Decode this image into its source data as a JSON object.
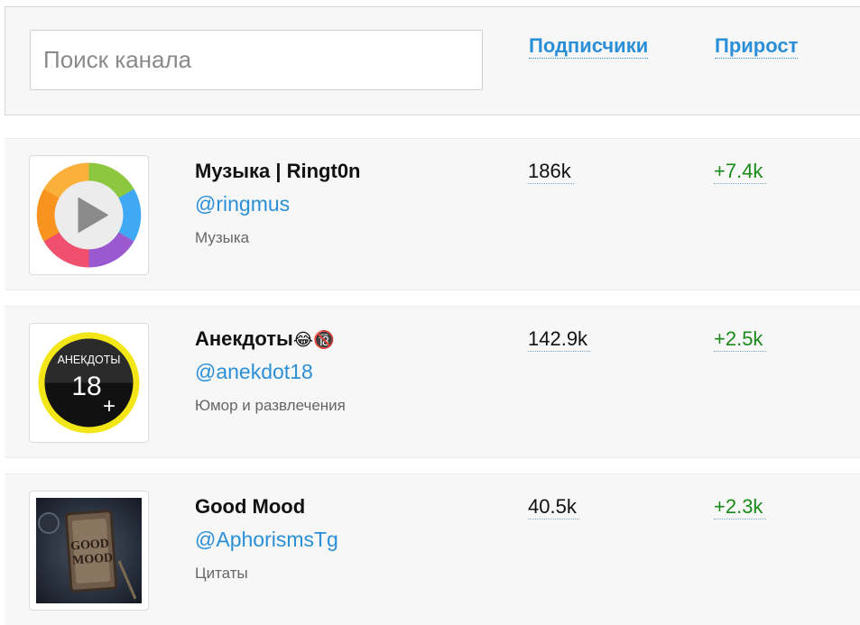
{
  "search": {
    "placeholder": "Поиск канала",
    "value": ""
  },
  "sort": {
    "subscribers_label": "Подписчики",
    "growth_label": "Прирост"
  },
  "channels": [
    {
      "name": "Музыка | Ringt0n",
      "name_emoji": "",
      "handle": "@ringmus",
      "category": "Музыка",
      "subscribers": "186k",
      "growth": "+7.4k",
      "avatar_icon": "music-play-icon"
    },
    {
      "name": "Анекдоты",
      "name_emoji": "😂🔞",
      "handle": "@anekdot18",
      "category": "Юмор и развлечения",
      "subscribers": "142.9k",
      "growth": "+2.5k",
      "avatar_icon": "anekdoty-18-plus-badge",
      "avatar_text": {
        "title": "АНЕКДОТЫ",
        "number": "18",
        "plus": "+"
      }
    },
    {
      "name": "Good Mood",
      "name_emoji": "",
      "handle": "@AphorismsTg",
      "category": "Цитаты",
      "subscribers": "40.5k",
      "growth": "+2.3k",
      "avatar_icon": "good-mood-sign-picture",
      "avatar_text": {
        "line1": "GOOD",
        "line2": "MOOD"
      }
    }
  ],
  "colors": {
    "link": "#2a8fd6",
    "growth": "#1a8a1a",
    "panel": "#f7f7f7"
  }
}
